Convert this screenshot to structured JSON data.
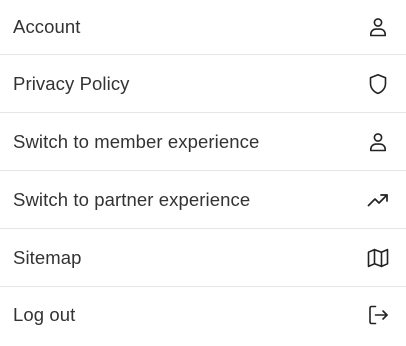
{
  "menu": {
    "items": [
      {
        "label": "Account",
        "icon": "user-icon"
      },
      {
        "label": "Privacy Policy",
        "icon": "shield-icon"
      },
      {
        "label": "Switch to member experience",
        "icon": "user-icon"
      },
      {
        "label": "Switch to partner experience",
        "icon": "trending-up-icon"
      },
      {
        "label": "Sitemap",
        "icon": "map-icon"
      },
      {
        "label": "Log out",
        "icon": "log-out-icon"
      }
    ]
  },
  "colors": {
    "text": "#333333",
    "divider": "#e6e6e6",
    "background": "#ffffff",
    "icon_stroke": "#222222"
  }
}
